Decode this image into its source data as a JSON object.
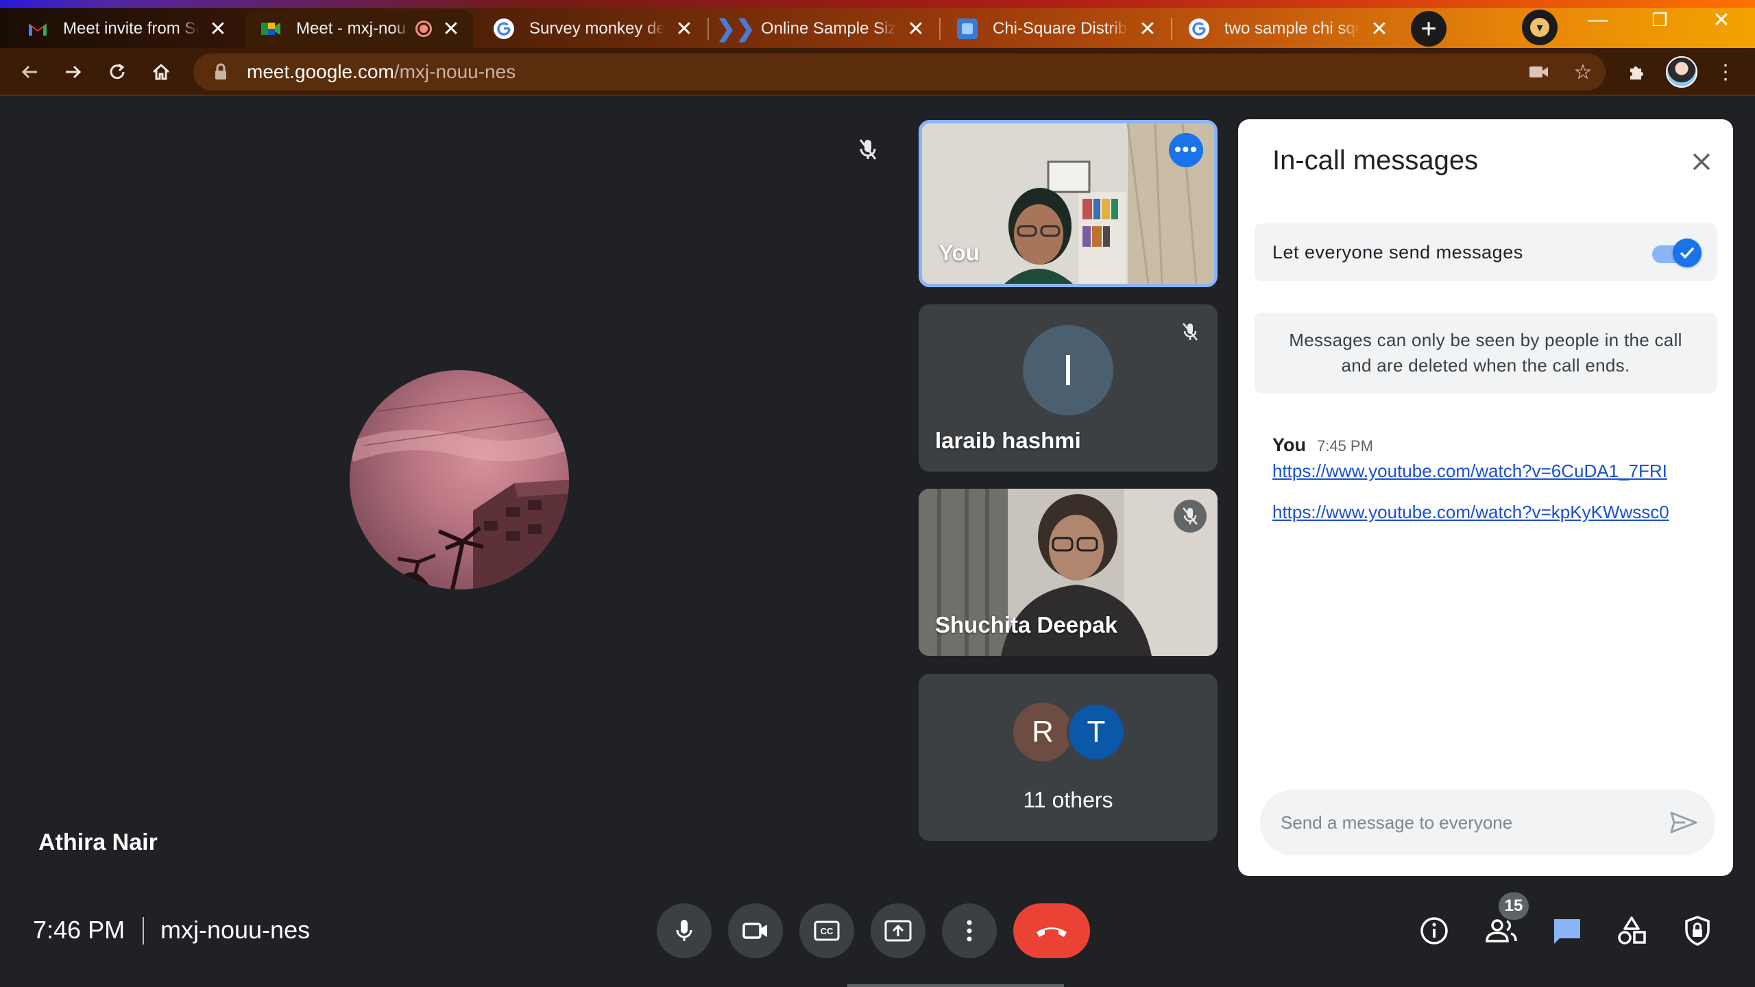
{
  "browser": {
    "tabs": [
      {
        "title": "Meet invite from Sc",
        "favicon": "gmail-icon"
      },
      {
        "title": "Meet - mxj-nou",
        "favicon": "meet-icon",
        "active": true,
        "recording": true
      },
      {
        "title": "Survey monkey dete",
        "favicon": "google-icon"
      },
      {
        "title": "Online Sample Size",
        "favicon": "chevron-logo-icon"
      },
      {
        "title": "Chi-Square Distribu",
        "favicon": "site-icon"
      },
      {
        "title": "two sample chi squ",
        "favicon": "google-icon"
      }
    ],
    "url_host": "meet.google.com",
    "url_path": "/mxj-nouu-nes"
  },
  "stage": {
    "main_participant_name": "Athira Nair"
  },
  "participants": {
    "you": {
      "name": "You"
    },
    "laraib": {
      "name": "laraib hashmi",
      "initial": "I"
    },
    "shuchita": {
      "name": "Shuchita Deepak"
    },
    "others": {
      "label": "11 others",
      "avatars": [
        {
          "initial": "R",
          "color": "#6d4c41"
        },
        {
          "initial": "T",
          "color": "#0b57a8"
        }
      ]
    }
  },
  "chat": {
    "title": "In-call messages",
    "setting_label": "Let everyone send messages",
    "setting_enabled": true,
    "notice_line1": "Messages can only be seen by people in the call",
    "notice_line2": "and are deleted when the call ends.",
    "messages": [
      {
        "sender": "You",
        "time": "7:45 PM",
        "links": [
          "https://www.youtube.com/watch?v=6CuDA1_7FRI",
          "https://www.youtube.com/watch?v=kpKyKWwssc0"
        ]
      }
    ],
    "input_placeholder": "Send a message to everyone"
  },
  "bottom_bar": {
    "time": "7:46 PM",
    "meeting_code": "mxj-nouu-nes",
    "people_count": "15"
  },
  "colors": {
    "accent": "#1a73e8",
    "hangup": "#ea4335",
    "chat_active": "#8ab4f8"
  }
}
